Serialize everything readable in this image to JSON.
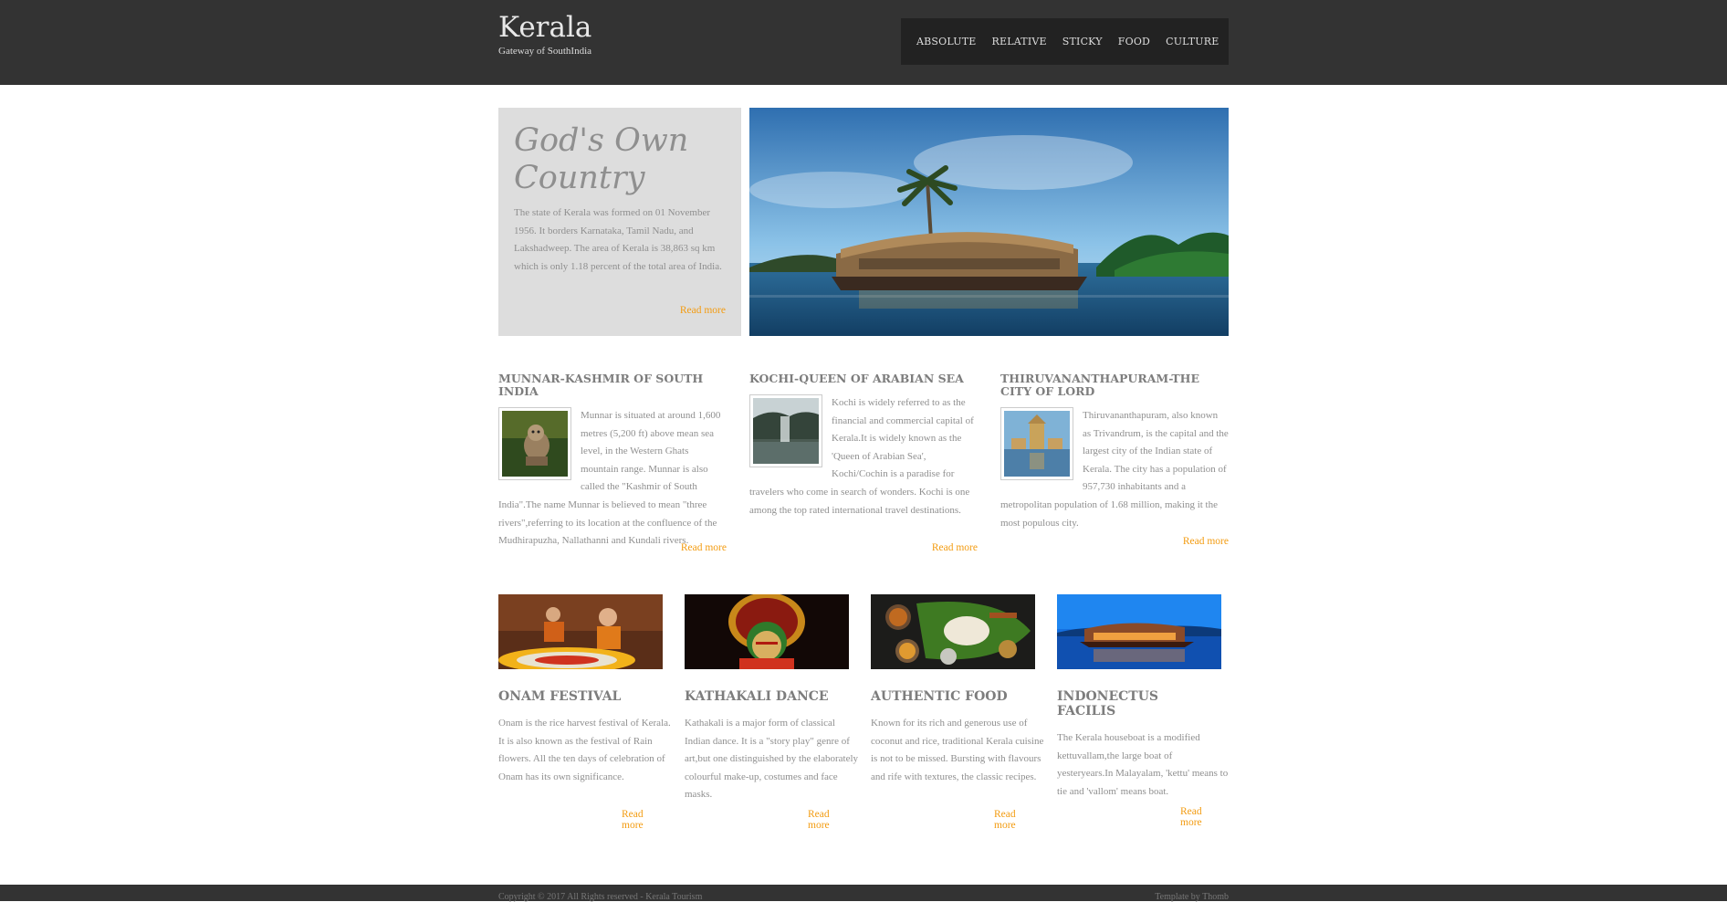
{
  "brand": {
    "title": "Kerala",
    "tagline": "Gateway of SouthIndia"
  },
  "nav": {
    "items": [
      "ABSOLUTE",
      "RELATIVE",
      "STICKY",
      "FOOD",
      "CULTURE"
    ]
  },
  "hero": {
    "title": "God's Own Country",
    "text": "The state of Kerala was formed on 01 November 1956. It borders Karnataka, Tamil Nadu, and Lakshadweep. The area of Kerala is 38,863 sq km which is only 1.18 percent of the total area of India.",
    "read_more": "Read more",
    "image_icon": "houseboat-photo"
  },
  "columns": [
    {
      "title": "MUNNAR-KASHMIR OF SOUTH INDIA",
      "text": "Munnar is situated at around 1,600 metres (5,200 ft) above mean sea level, in the Western Ghats mountain range. Munnar is also called the \"Kashmir of South India\".The name Munnar is believed to mean \"three rivers\",referring to its location at the confluence of the Mudhirapuzha, Nallathanni and Kundali rivers.",
      "read_more": "Read more",
      "thumb_icon": "monkey-photo"
    },
    {
      "title": "KOCHI-QUEEN OF ARABIAN SEA",
      "text": "Kochi is widely referred to as the financial and commercial capital of Kerala.It is widely known as the 'Queen of Arabian Sea', Kochi/Cochin is a paradise for travelers who come in search of wonders. Kochi is one among the top rated international travel destinations.",
      "read_more": "Read more",
      "thumb_icon": "waterfall-photo"
    },
    {
      "title": "THIRUVANANTHAPURAM-THE CITY OF LORD",
      "text": "Thiruvananthapuram, also known as Trivandrum, is the capital and the largest city of the Indian state of Kerala. The city has a population of 957,730 inhabitants and a metropolitan population of 1.68 million, making it the most populous city.",
      "read_more": "Read more",
      "thumb_icon": "temple-photo"
    }
  ],
  "cards": [
    {
      "title": "ONAM FESTIVAL",
      "text": "Onam is the rice harvest festival of Kerala. It is also known as the festival of Rain flowers. All the ten days of celebration of Onam has its own significance.",
      "read_more": "Read more",
      "image_icon": "onam-photo"
    },
    {
      "title": "KATHAKALI DANCE",
      "text": "Kathakali is a major form of classical Indian dance. It is a \"story play\" genre of art,but one distinguished by the elaborately colourful make-up, costumes and face masks.",
      "read_more": "Read more",
      "image_icon": "kathakali-photo"
    },
    {
      "title": "AUTHENTIC FOOD",
      "text": "Known for its rich and generous use of coconut and rice, traditional Kerala cuisine is not to be missed. Bursting with flavours and rife with textures, the classic recipes.",
      "read_more": "Read more",
      "image_icon": "food-photo"
    },
    {
      "title": "INDONECTUS FACILIS",
      "text": "The Kerala houseboat is a modified kettuvallam,the large boat of yesteryears.In Malayalam, 'kettu' means to tie and 'vallom' means boat.",
      "read_more": "Read more",
      "image_icon": "houseboat-night-photo"
    }
  ],
  "footer": {
    "left": "Copyright © 2017 All Rights reserved - Kerala Tourism",
    "right": "Template by Thomb"
  },
  "colors": {
    "header_bg": "#333333",
    "nav_bg": "#222222",
    "hero_box_bg": "#dddddd",
    "accent": "#f39c12",
    "text": "#8f8f8f"
  }
}
